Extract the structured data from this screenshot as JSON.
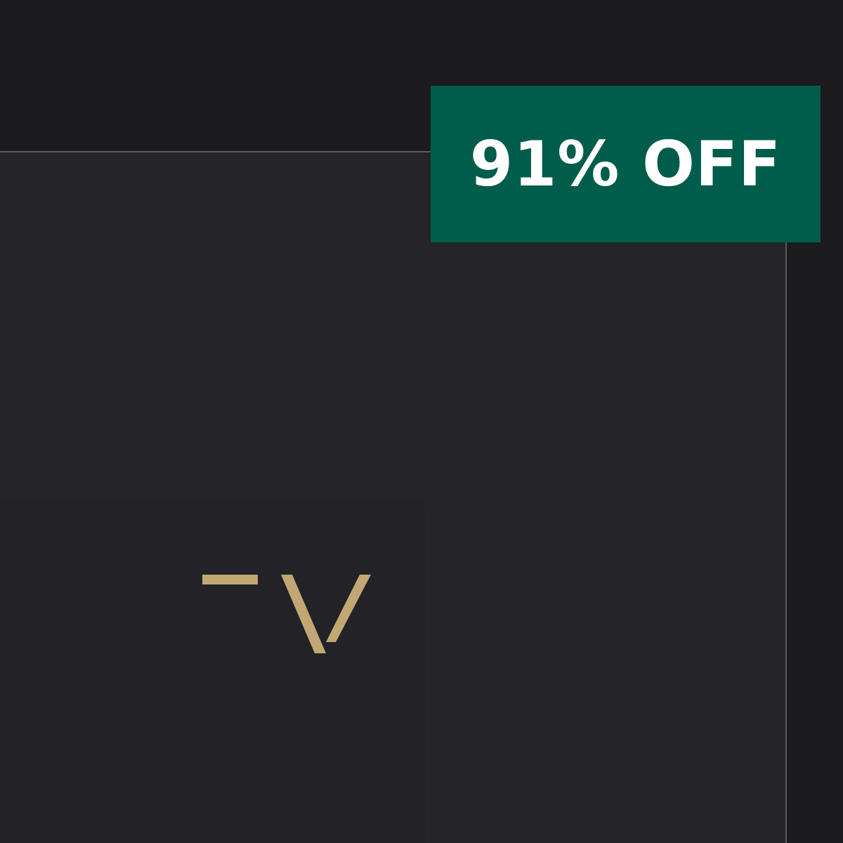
{
  "badge": {
    "label": "91% OFF",
    "background": "#005c4b",
    "text_color": "#ffffff"
  },
  "logo": {
    "icon": "brand-logo-icon",
    "color": "#c2a774"
  },
  "colors": {
    "page_background": "#1b1a1c",
    "card_background": "#252426",
    "card_border": "#5a595c"
  }
}
